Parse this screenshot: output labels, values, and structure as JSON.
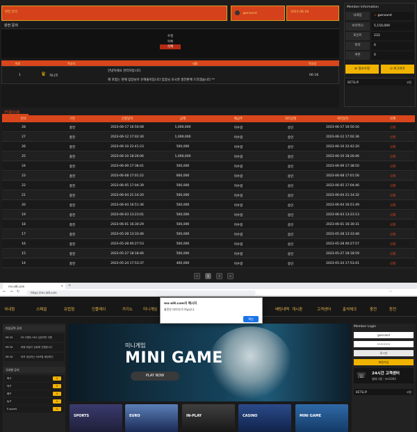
{
  "top": {
    "title": "완전 문의",
    "user": "gwnsand",
    "date": "2023-06-18"
  },
  "question_panel": {
    "title": "완전 문의",
    "line1": "수정",
    "line2": "목록",
    "delete_label": "삭제",
    "head": [
      "번호",
      "작성자",
      "내용",
      "작성일"
    ],
    "row": {
      "num": "1",
      "author": "자니코",
      "msg1": "안녕하세요 관리자입니다.",
      "msg2": "해 포함는 현재 입장님이 유해물이입니다 입장님 모시면 충전판매 드리겠습니다 **",
      "date": "06-18"
    }
  },
  "member": {
    "title": "Member Information",
    "rows": [
      {
        "label": "닉네임",
        "value": "gwnsand"
      },
      {
        "label": "보유머니",
        "value": "5,150,049"
      },
      {
        "label": "포인트",
        "value": "233"
      },
      {
        "label": "쪽지",
        "value": "0"
      },
      {
        "label": "쿠폰",
        "value": "0"
      }
    ],
    "btn_edit": "정보수정",
    "btn_logout": "로그아웃",
    "betslip": "BETSLIP",
    "betslip_right": "고정"
  },
  "history": {
    "tab": "전체삭제",
    "headers": [
      "번호",
      "구분",
      "신청일자",
      "금액",
      "예금주",
      "처리상태",
      "처리일자",
      "삭제"
    ],
    "rows": [
      [
        "28",
        "충전",
        "2023-06-17 16:50:08",
        "1,000,000",
        "이수걸",
        "승인",
        "2023-06-17 16:50:16",
        "삭제"
      ],
      [
        "27",
        "충전",
        "2023-06-12 17:02:30",
        "1,000,000",
        "이수걸",
        "승인",
        "2023-06-12 17:02:36",
        "삭제"
      ],
      [
        "26",
        "충전",
        "2023-06-10 22:41:23",
        "500,000",
        "이수걸",
        "승인",
        "2023-06-10 22:42:20",
        "삭제"
      ],
      [
        "25",
        "충전",
        "2023-06-10 18:26:06",
        "1,000,000",
        "이수걸",
        "승인",
        "2023-06-10 18:26:46",
        "삭제"
      ],
      [
        "24",
        "충전",
        "2023-06-09 17:38:41",
        "500,000",
        "이수걸",
        "승인",
        "2023-06-09 17:38:50",
        "삭제"
      ],
      [
        "23",
        "충전",
        "2023-06-08 17:01:22",
        "600,000",
        "이수걸",
        "승인",
        "2023-06-08 17:01:56",
        "삭제"
      ],
      [
        "22",
        "충전",
        "2023-06-05 17:04:39",
        "500,000",
        "이수걸",
        "승인",
        "2023-06-05 17:04:46",
        "삭제"
      ],
      [
        "21",
        "충전",
        "2023-06-04 21:14:20",
        "500,000",
        "이수걸",
        "승인",
        "2023-06-04 21:14:32",
        "삭제"
      ],
      [
        "20",
        "충전",
        "2023-06-04 16:51:36",
        "500,000",
        "이수걸",
        "승인",
        "2023-06-04 16:51:49",
        "삭제"
      ],
      [
        "19",
        "충전",
        "2023-06-03 13:23:01",
        "500,000",
        "이수걸",
        "승인",
        "2023-06-03 13:23:13",
        "삭제"
      ],
      [
        "18",
        "충전",
        "2023-06-01 16:30:29",
        "500,000",
        "이수걸",
        "승인",
        "2023-06-01 16:30:31",
        "삭제"
      ],
      [
        "17",
        "충전",
        "2023-05-28 13:33:46",
        "500,000",
        "이수걸",
        "승인",
        "2023-05-28 13:33:48",
        "삭제"
      ],
      [
        "16",
        "충전",
        "2023-05-28 00:27:53",
        "500,000",
        "이수걸",
        "승인",
        "2023-05-28 00:27:57",
        "삭제"
      ],
      [
        "15",
        "충전",
        "2023-05-27 18:18:46",
        "500,000",
        "이수걸",
        "승인",
        "2023-05-27 18:18:59",
        "삭제"
      ],
      [
        "14",
        "충전",
        "2023-05-24 17:53:37",
        "400,000",
        "이수걸",
        "승인",
        "2023-05-24 17:53:41",
        "삭제"
      ]
    ],
    "pager": [
      "<",
      "1",
      "2",
      ">"
    ]
  },
  "browser": {
    "tab_title": "ms-al8.com",
    "url": "https://ms-al8.com",
    "dialog_title": "ms-al8.com의 메시지",
    "dialog_msg": "충전은 마이다가 아닙니다.",
    "dialog_ok": "확인"
  },
  "site": {
    "nav": [
      "국내형",
      "스페셜",
      "유럽형",
      "인플레이",
      "카지노",
      "미니게임",
      "배팅내역",
      "게시판",
      "고객센터",
      "출석체크",
      "충전",
      "환전"
    ],
    "left_head1": "미섬공략 공지",
    "left_rows": [
      {
        "badge": "EB 3X",
        "text": "EB 이벤트 EB4 입장하면 지원"
      },
      {
        "badge": "EB 3X",
        "text": "회원 매달이 입회에 진행됩니다"
      },
      {
        "badge": "EB 3X",
        "text": "축포 생성하는 EB포함 배당확인"
      }
    ],
    "left_head2": "국내형 공지",
    "sports": [
      {
        "name": "축구",
        "count": "0"
      },
      {
        "name": "야구",
        "count": "0"
      },
      {
        "name": "배구",
        "count": "0"
      },
      {
        "name": "농구",
        "count": "0"
      },
      {
        "name": "E-sports",
        "count": "0"
      }
    ],
    "banner_small": "미니게임",
    "banner_big": "MINI GAME",
    "banner_btn": "PLAY NOW",
    "cards": [
      "SPORTS",
      "EURO",
      "IN-PLAY",
      "CASINO",
      "MINI GAME"
    ],
    "login_title": "Member Login",
    "login_id": "gwnsand",
    "login_pw": "••••••••",
    "login_btn": "로그인",
    "join_btn": "회원가입",
    "cs_title": "24시간 고객센터",
    "cs_sub": "텔레그램 : ms1004",
    "betslip": "BETSLIP",
    "betslip_right": "고정"
  }
}
